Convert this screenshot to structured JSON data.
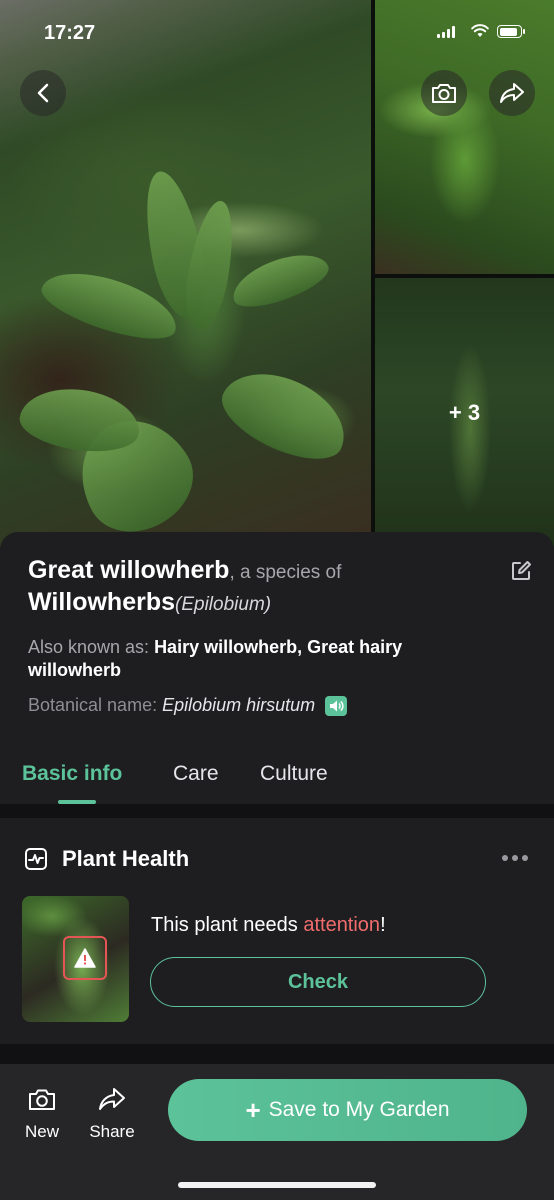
{
  "status_bar": {
    "time": "17:27"
  },
  "photos": {
    "more_count": "+ 3"
  },
  "plant": {
    "common_name": "Great willowherb",
    "species_of_text": ", a species of",
    "genus_name": "Willowherbs",
    "genus_latin": "(Epilobium)",
    "aka_label": "Also known as: ",
    "aka_values": "Hairy willowherb, Great hairy willowherb",
    "botanical_label": "Botanical name:",
    "botanical_value": "Epilobium hirsutum"
  },
  "tabs": [
    {
      "label": "Basic info",
      "active": true
    },
    {
      "label": "Care",
      "active": false
    },
    {
      "label": "Culture",
      "active": false
    }
  ],
  "health_card": {
    "title": "Plant Health",
    "message_prefix": "This plant needs ",
    "message_highlight": "attention",
    "message_suffix": "!",
    "check_label": "Check"
  },
  "bottom_bar": {
    "new_label": "New",
    "share_label": "Share",
    "save_label": "Save to My Garden"
  },
  "colors": {
    "accent": "#5cc29a",
    "warning": "#f06c6c",
    "sheet_bg": "#1e1e20"
  },
  "icons": [
    "back-icon",
    "camera-icon",
    "share-icon",
    "edit-icon",
    "speaker-icon",
    "heart-rate-icon",
    "more-icon",
    "warning-icon",
    "plus-icon"
  ]
}
